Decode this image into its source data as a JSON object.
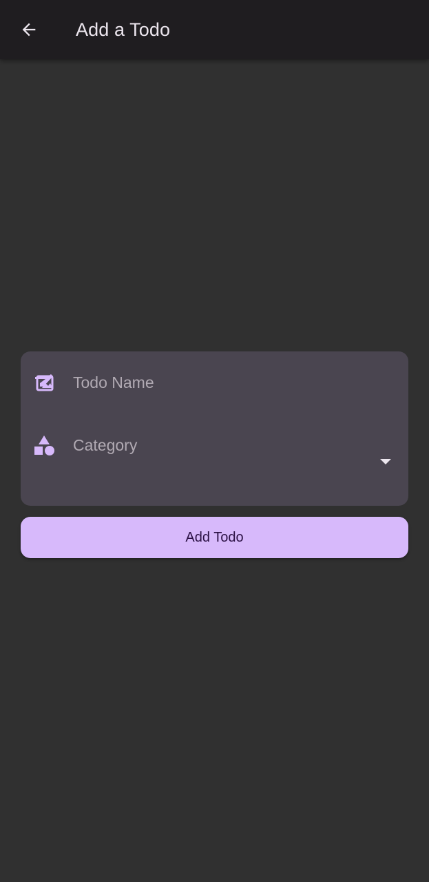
{
  "app_bar": {
    "back_icon": "arrow-back-icon",
    "title": "Add a Todo"
  },
  "form": {
    "todo_name": {
      "icon": "edit-note-icon",
      "placeholder": "Todo Name",
      "value": ""
    },
    "category": {
      "icon": "category-shapes-icon",
      "label": "Category",
      "selected": "",
      "dropdown_icon": "arrow-drop-down-icon"
    }
  },
  "actions": {
    "add_label": "Add Todo"
  },
  "colors": {
    "background": "#303030",
    "app_bar": "#1f1d20",
    "card": "#4a4550",
    "accent": "#d7b9fb",
    "button_text": "#2b1144",
    "title_text": "#ece6ee",
    "hint_text": "#b1aab3"
  }
}
